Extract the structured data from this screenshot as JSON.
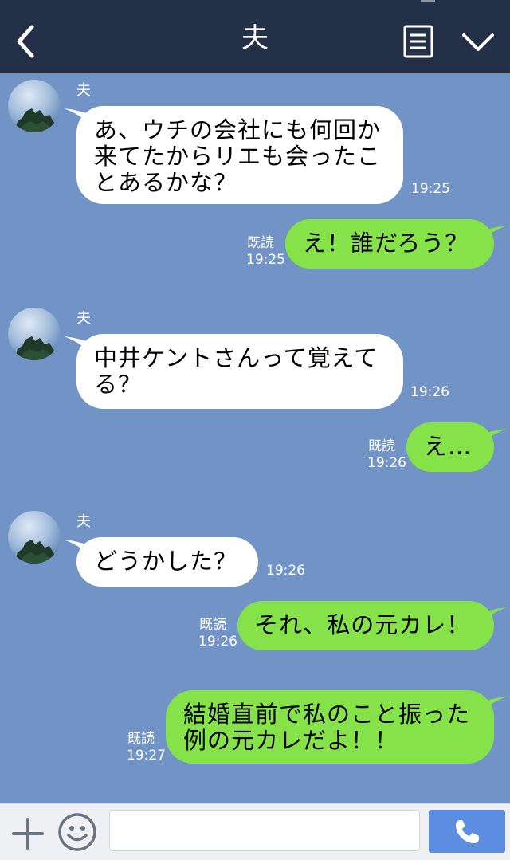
{
  "header": {
    "title": "夫",
    "back_icon": "chevron-left-icon",
    "menu_icon": "list-icon",
    "collapse_icon": "chevron-down-icon"
  },
  "colors": {
    "header_bg": "#243048",
    "chat_bg": "#7293c5",
    "incoming_bubble": "#ffffff",
    "outgoing_bubble": "#85e249",
    "call_button": "#5b8ee0"
  },
  "messages": [
    {
      "direction": "in",
      "sender": "夫",
      "text": "あ、ウチの会社にも何回か\n来てたからリエも会ったこ\nとあるかな？",
      "time": "19:25"
    },
    {
      "direction": "out",
      "read": "既読",
      "text": "え！誰だろう？",
      "time": "19:25"
    },
    {
      "direction": "in",
      "sender": "夫",
      "text": "中井ケントさんって覚えて\nる？",
      "time": "19:26"
    },
    {
      "direction": "out",
      "read": "既読",
      "text": "え…",
      "time": "19:26"
    },
    {
      "direction": "in",
      "sender": "夫",
      "text": "どうかした？",
      "time": "19:26"
    },
    {
      "direction": "out",
      "read": "既読",
      "text": "それ、私の元カレ！",
      "time": "19:26"
    },
    {
      "direction": "out",
      "read": "既読",
      "text": "結婚直前で私のこと振った\n例の元カレだよ！！",
      "time": "19:27"
    }
  ],
  "footer": {
    "plus_icon": "plus-icon",
    "emoji_icon": "smiley-icon",
    "input_value": "",
    "input_placeholder": "",
    "call_icon": "phone-icon"
  }
}
